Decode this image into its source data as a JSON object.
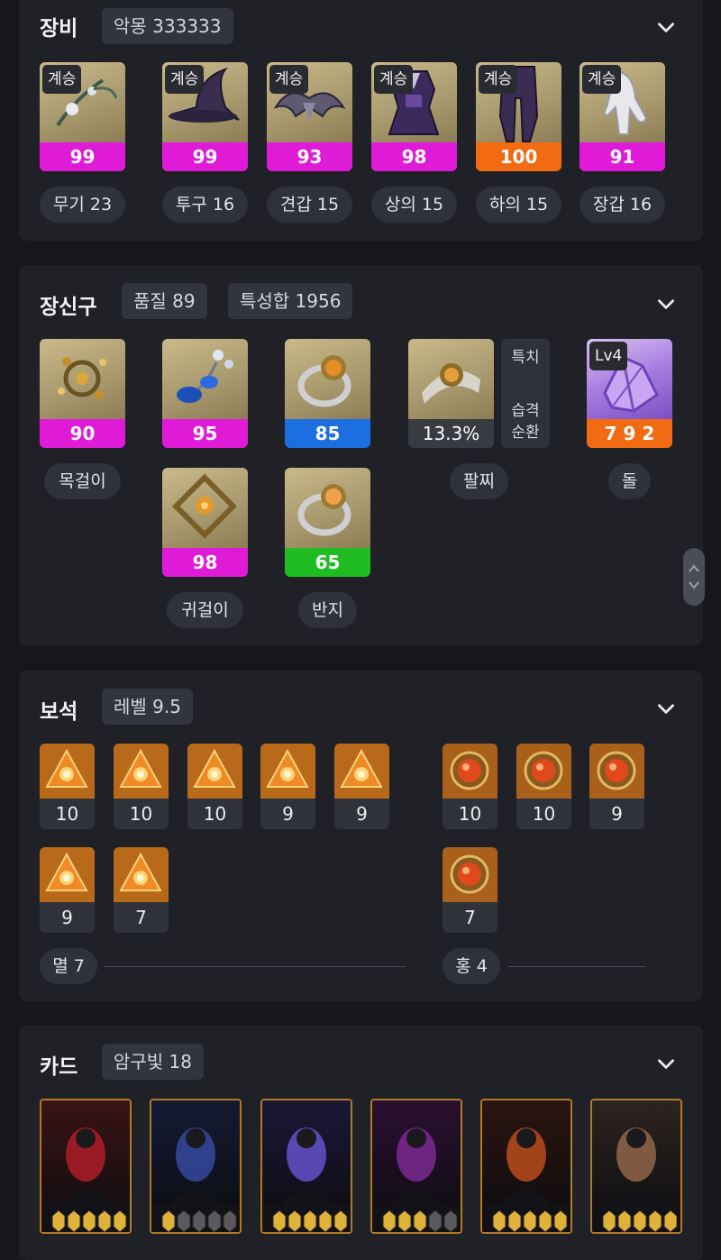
{
  "equipment": {
    "title": "장비",
    "chip": "악몽 333333",
    "items": [
      {
        "badge": "계승",
        "value": "99",
        "label": "무기 23",
        "color": "magenta",
        "icon": "weapon-staff-icon"
      },
      {
        "badge": "계승",
        "value": "99",
        "label": "투구 16",
        "color": "magenta",
        "icon": "witch-hat-icon"
      },
      {
        "badge": "계승",
        "value": "93",
        "label": "견갑 15",
        "color": "magenta",
        "icon": "shoulder-armor-icon"
      },
      {
        "badge": "계승",
        "value": "98",
        "label": "상의 15",
        "color": "magenta",
        "icon": "dress-icon"
      },
      {
        "badge": "계승",
        "value": "100",
        "label": "하의 15",
        "color": "orange",
        "icon": "leggings-icon"
      },
      {
        "badge": "계승",
        "value": "91",
        "label": "장갑 16",
        "color": "magenta",
        "icon": "glove-icon"
      }
    ]
  },
  "accessories": {
    "title": "장신구",
    "chip1": "품질 89",
    "chip2": "특성합 1956",
    "necklace": {
      "value": "90",
      "label": "목걸이",
      "icon": "necklace-icon"
    },
    "earring1": {
      "value": "95",
      "icon": "earring-icon"
    },
    "earring2": {
      "value": "98",
      "label": "귀걸이",
      "icon": "earring-icon"
    },
    "ring1": {
      "value": "85",
      "icon": "ring-icon"
    },
    "ring2": {
      "value": "65",
      "label": "반지",
      "icon": "ring-icon"
    },
    "bracelet": {
      "value": "13.3%",
      "label": "팔찌",
      "stats": [
        "특치",
        "습격",
        "순환"
      ],
      "icon": "bracelet-icon"
    },
    "stone": {
      "badge": "Lv4",
      "value": "7 9 2",
      "label": "돌",
      "icon": "ability-stone-icon"
    }
  },
  "gems": {
    "title": "보석",
    "chip": "레벨 9.5",
    "annihilation": {
      "levels": [
        "10",
        "10",
        "10",
        "9",
        "9",
        "9",
        "7"
      ],
      "summary": "멸 7"
    },
    "crimson": {
      "levels": [
        "10",
        "10",
        "9",
        "7"
      ],
      "summary": "홍 4"
    }
  },
  "cards": {
    "title": "카드",
    "chip": "암구빛 18",
    "items": [
      {
        "awaken": 5
      },
      {
        "awaken": 1
      },
      {
        "awaken": 5
      },
      {
        "awaken": 3
      },
      {
        "awaken": 5
      },
      {
        "awaken": 5
      }
    ]
  },
  "colors": {
    "magenta": "#e01bd8",
    "orange": "#f26a11",
    "blue": "#1b6fe0",
    "green": "#1fbd22"
  }
}
